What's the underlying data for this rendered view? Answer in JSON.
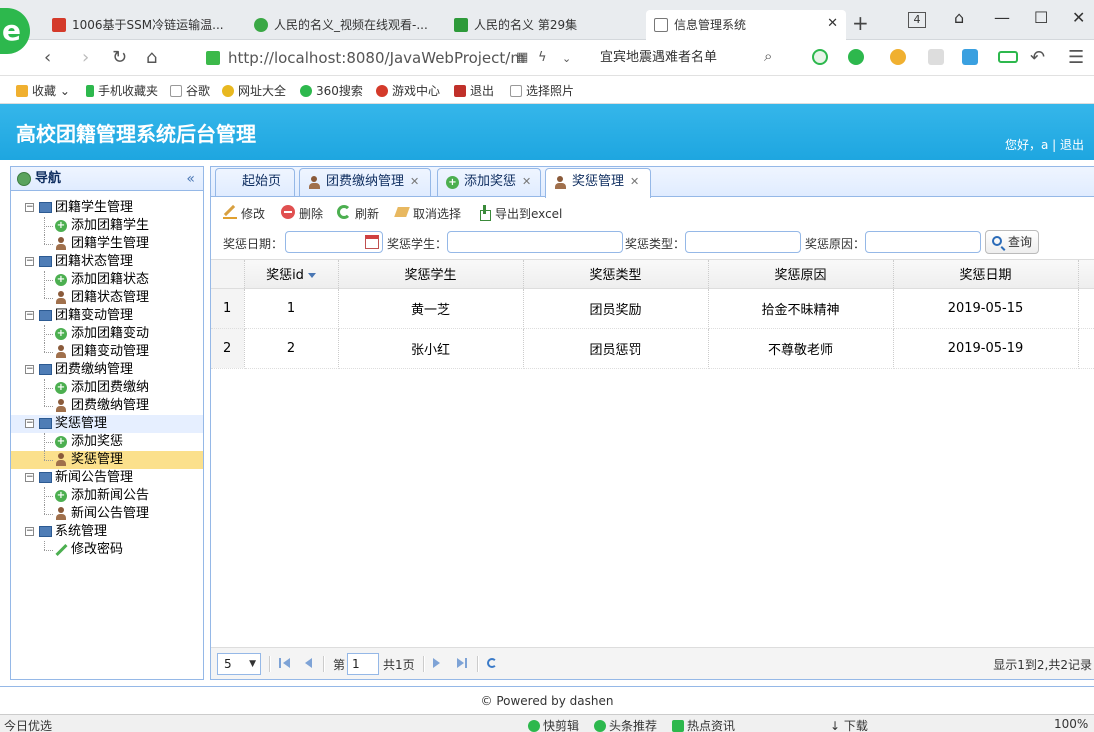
{
  "browser": {
    "tabs": [
      {
        "title": "1006基于SSM冷链运输温...",
        "color": "#d43a2a"
      },
      {
        "title": "人民的名义_视频在线观看-...",
        "color": "#3aa845"
      },
      {
        "title": "人民的名义 第29集",
        "color": "#2e9a3a"
      },
      {
        "title": "信息管理系统",
        "color": "#777777"
      }
    ],
    "tab_count": "4",
    "url": "http://localhost:8080/JavaWebProject/m",
    "url_host": "localhost",
    "search_text": "宜宾地震遇难者名单",
    "bookmarks": [
      "收藏",
      "手机收藏夹",
      "谷歌",
      "网址大全",
      "360搜索",
      "游戏中心",
      "退出",
      "选择照片"
    ]
  },
  "app": {
    "title": "高校团籍管理系统后台管理",
    "user_greeting": "您好，a",
    "logout": "退出",
    "accent_color": "#1ea6e0"
  },
  "sidebar": {
    "title": "导航",
    "groups": [
      {
        "label": "团籍学生管理",
        "items": [
          {
            "label": "添加团籍学生",
            "icon": "add-icon"
          },
          {
            "label": "团籍学生管理",
            "icon": "user-icon"
          }
        ]
      },
      {
        "label": "团籍状态管理",
        "items": [
          {
            "label": "添加团籍状态",
            "icon": "add-icon"
          },
          {
            "label": "团籍状态管理",
            "icon": "user-icon"
          }
        ]
      },
      {
        "label": "团籍变动管理",
        "items": [
          {
            "label": "添加团籍变动",
            "icon": "add-icon"
          },
          {
            "label": "团籍变动管理",
            "icon": "user-icon"
          }
        ]
      },
      {
        "label": "团费缴纳管理",
        "items": [
          {
            "label": "添加团费缴纳",
            "icon": "add-icon"
          },
          {
            "label": "团费缴纳管理",
            "icon": "user-icon"
          }
        ]
      },
      {
        "label": "奖惩管理",
        "items": [
          {
            "label": "添加奖惩",
            "icon": "add-icon"
          },
          {
            "label": "奖惩管理",
            "icon": "user-icon"
          }
        ]
      },
      {
        "label": "新闻公告管理",
        "items": [
          {
            "label": "添加新闻公告",
            "icon": "add-icon"
          },
          {
            "label": "新闻公告管理",
            "icon": "user-icon"
          }
        ]
      },
      {
        "label": "系统管理",
        "items": [
          {
            "label": "修改密码",
            "icon": "pencil-icon"
          }
        ]
      }
    ]
  },
  "main": {
    "tabs": [
      {
        "label": "起始页",
        "closable": false
      },
      {
        "label": "团费缴纳管理",
        "closable": true
      },
      {
        "label": "添加奖惩",
        "closable": true
      },
      {
        "label": "奖惩管理",
        "closable": true
      }
    ],
    "toolbar": {
      "edit": "修改",
      "delete": "删除",
      "refresh": "刷新",
      "cancel_select": "取消选择",
      "export": "导出到excel"
    },
    "search": {
      "date_label": "奖惩日期：",
      "student_label": "奖惩学生：",
      "type_label": "奖惩类型：",
      "reason_label": "奖惩原因：",
      "query": "查询"
    },
    "table": {
      "columns": [
        "奖惩id",
        "奖惩学生",
        "奖惩类型",
        "奖惩原因",
        "奖惩日期"
      ],
      "rows": [
        {
          "rn": "1",
          "id": "1",
          "student": "黄一芝",
          "type": "团员奖励",
          "reason": "拾金不昧精神",
          "date": "2019-05-15"
        },
        {
          "rn": "2",
          "id": "2",
          "student": "张小红",
          "type": "团员惩罚",
          "reason": "不尊敬老师",
          "date": "2019-05-19"
        }
      ]
    },
    "pager": {
      "page_size": "5",
      "page_prefix": "第",
      "page_value": "1",
      "page_suffix": "共1页",
      "info": "显示1到2,共2记录"
    }
  },
  "footer": "© Powered by dashen",
  "statusbar": {
    "left": "今日优选",
    "items": [
      "快剪辑",
      "头条推荐",
      "热点资讯",
      "下载",
      "100%"
    ]
  }
}
